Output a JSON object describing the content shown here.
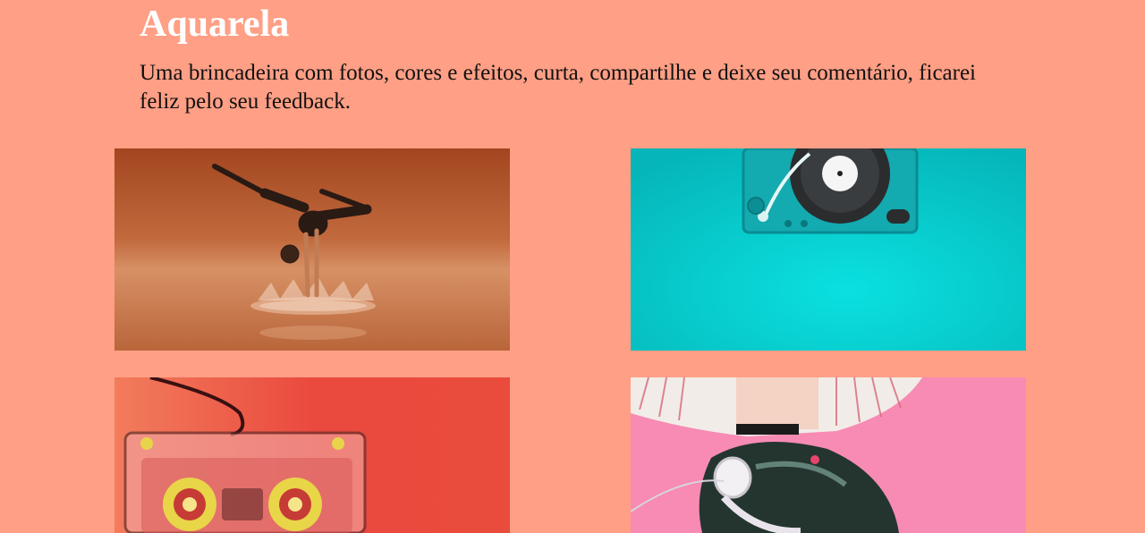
{
  "header": {
    "title": "Aquarela",
    "description": "Uma brincadeira com fotos, cores e efeitos, curta, compartilhe e deixe seu comentário, ficarei feliz pelo seu feedback."
  },
  "gallery": {
    "photos": [
      {
        "subject": "yoga-dancer-on-water",
        "accent": "#b0542a"
      },
      {
        "subject": "turntable-on-teal",
        "accent": "#0bcfd2"
      },
      {
        "subject": "cassette-tape-on-red",
        "accent": "#e94b3c"
      },
      {
        "subject": "girl-with-headphones-on-pink",
        "accent": "#f78bb4"
      }
    ]
  },
  "colors": {
    "background": "#ff9f85",
    "title": "#ffffff",
    "text": "#111111"
  }
}
